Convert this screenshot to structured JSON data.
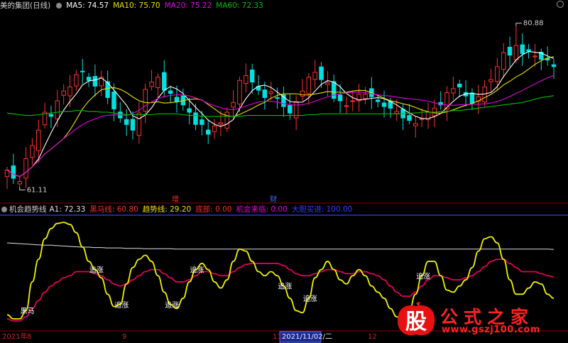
{
  "upper_panel": {
    "stock_name": "美的集团(日线)",
    "ma": [
      {
        "label": "MA5: 74.57",
        "color": "#ffffff"
      },
      {
        "label": "MA10: 75.70",
        "color": "#e8e000"
      },
      {
        "label": "MA20: 75.22",
        "color": "#e000e0"
      },
      {
        "label": "MA60: 72.33",
        "color": "#00c000"
      }
    ],
    "max_label": "80.88",
    "min_label": "61.11"
  },
  "lower_panel": {
    "indicator_name": "机会趋势线",
    "a1_label": "A1: 72.33",
    "items": [
      {
        "label": "黑马线: 60.80",
        "color": "#ff2a2a"
      },
      {
        "label": "趋势线: 29.20",
        "color": "#e8e000"
      },
      {
        "label": "底部: 0.00",
        "color": "#ff2a2a"
      },
      {
        "label": "机会来临: 0.00",
        "color": "#e000e0"
      },
      {
        "label": "大胆买进: 100.00",
        "color": "#3040ff"
      }
    ],
    "event_zeng": "增",
    "event_cai": "财"
  },
  "annotations": {
    "heima": "黑马",
    "zhuizhang": "追涨"
  },
  "time_axis": {
    "year": "2021年",
    "m8": "8",
    "m9": "9",
    "m11": "11",
    "m12": "12",
    "cursor_date": "2021/11/02/二"
  },
  "watermark": {
    "logo_char": "股",
    "title": "公式之家",
    "url": "www.gszj100.com"
  },
  "chart_data": [
    {
      "type": "candlestick",
      "title": "美的集团(日线)",
      "series_names": [
        "MA5",
        "MA10",
        "MA20",
        "MA60"
      ],
      "colors": {
        "up": "#ff3030",
        "down": "#00e0e0",
        "ma5": "#ffffff",
        "ma10": "#e8e000",
        "ma20": "#e000e0",
        "ma60": "#00c000"
      },
      "ylim": [
        59.5,
        82.5
      ],
      "highest": 80.88,
      "lowest": 61.11,
      "close": [
        63.2,
        62.2,
        61.8,
        64.6,
        66.2,
        68.1,
        70.3,
        69.8,
        71.7,
        72.9,
        73.4,
        74.9,
        75.3,
        74.2,
        73.5,
        74.6,
        72.1,
        70.7,
        69.6,
        68.8,
        68.1,
        70.2,
        73.1,
        74.0,
        74.6,
        73.0,
        72.6,
        71.6,
        71.2,
        70.3,
        68.8,
        68.8,
        67.6,
        68.6,
        69.0,
        70.3,
        71.5,
        74.2,
        74.8,
        74.0,
        73.0,
        72.1,
        72.8,
        72.0,
        71.0,
        70.2,
        71.6,
        72.9,
        74.6,
        75.2,
        74.3,
        73.9,
        72.0,
        71.7,
        71.1,
        71.7,
        72.5,
        72.5,
        72.2,
        71.6,
        71.0,
        70.8,
        70.4,
        69.6,
        69.3,
        68.9,
        69.5,
        70.3,
        70.8,
        71.2,
        72.7,
        73.2,
        73.4,
        72.3,
        71.4,
        72.2,
        73.4,
        74.3,
        75.9,
        77.6,
        77.3,
        78.5,
        77.5,
        77.8,
        77.2,
        76.8,
        76.7,
        75.9
      ],
      "ma60": [
        70.2,
        70.1,
        70.0,
        69.9,
        69.9,
        70.0,
        70.1,
        70.2,
        70.3,
        70.4,
        70.4,
        70.5,
        70.5,
        70.4,
        70.4,
        70.3,
        70.3,
        70.2,
        70.1,
        70.0,
        70.0,
        70.0,
        70.0,
        70.0,
        70.1,
        70.1,
        70.1,
        70.1,
        70.0,
        69.9,
        69.9,
        69.8,
        69.8,
        69.8,
        69.8,
        69.8,
        69.8,
        69.8,
        69.9,
        69.9,
        69.9,
        69.9,
        69.9,
        69.9,
        69.9,
        69.9,
        69.9,
        69.9,
        70.0,
        70.0,
        70.1,
        70.1,
        70.1,
        70.1,
        70.1,
        70.1,
        70.1,
        70.1,
        70.1,
        70.1,
        70.1,
        70.1,
        70.1,
        70.1,
        70.2,
        70.2,
        70.3,
        70.3,
        70.3,
        70.4,
        70.4,
        70.5,
        70.5,
        70.6,
        70.7,
        70.8,
        70.9,
        71.0,
        71.1,
        71.2,
        71.3,
        71.4,
        71.5,
        71.7,
        71.9,
        72.1,
        72.2,
        72.33
      ]
    },
    {
      "type": "line",
      "title": "机会趋势线",
      "series_names": [
        "黑马线",
        "趋势线",
        "A1"
      ],
      "colors": {
        "heima": "#e0005a",
        "trend": "#f0f000",
        "a1": "#e0e0e0",
        "top_line": "#3040ff"
      },
      "ylim": [
        -5,
        105
      ],
      "trend": [
        8,
        4,
        4,
        12,
        40,
        62,
        82,
        92,
        97,
        98,
        96,
        88,
        74,
        60,
        52,
        44,
        28,
        16,
        18,
        38,
        54,
        62,
        66,
        60,
        46,
        30,
        18,
        14,
        24,
        40,
        52,
        58,
        52,
        40,
        34,
        42,
        60,
        72,
        70,
        60,
        50,
        46,
        50,
        46,
        36,
        24,
        12,
        10,
        24,
        44,
        52,
        60,
        52,
        42,
        38,
        46,
        52,
        46,
        36,
        30,
        24,
        14,
        6,
        2,
        12,
        28,
        46,
        60,
        60,
        46,
        32,
        30,
        36,
        42,
        54,
        70,
        82,
        84,
        78,
        62,
        42,
        28,
        28,
        34,
        40,
        38,
        28,
        24
      ],
      "heima": [
        4,
        2,
        2,
        6,
        14,
        22,
        30,
        36,
        40,
        44,
        46,
        50,
        50,
        50,
        48,
        46,
        42,
        38,
        36,
        38,
        42,
        46,
        50,
        52,
        52,
        48,
        44,
        40,
        40,
        42,
        46,
        50,
        50,
        48,
        46,
        46,
        50,
        54,
        57,
        58,
        58,
        58,
        58,
        58,
        56,
        52,
        48,
        46,
        46,
        48,
        50,
        52,
        52,
        50,
        48,
        48,
        50,
        50,
        48,
        46,
        42,
        36,
        30,
        26,
        26,
        30,
        36,
        42,
        46,
        46,
        44,
        42,
        42,
        44,
        46,
        50,
        55,
        60,
        62,
        62,
        58,
        54,
        50,
        50,
        50,
        48,
        46,
        45
      ],
      "a1": [
        74.0,
        73.9,
        73.8,
        73.7,
        73.6,
        73.5,
        73.4,
        73.4,
        73.3,
        73.2,
        73.1,
        73.0,
        72.9,
        72.9,
        72.8,
        72.8,
        72.7,
        72.7,
        72.7,
        72.6,
        72.6,
        72.6,
        72.5,
        72.5,
        72.5,
        72.5,
        72.5,
        72.4,
        72.4,
        72.4,
        72.4,
        72.4,
        72.4,
        72.4,
        72.4,
        72.4,
        72.4,
        72.4,
        72.4,
        72.4,
        72.4,
        72.4,
        72.4,
        72.4,
        72.4,
        72.4,
        72.4,
        72.4,
        72.4,
        72.4,
        72.4,
        72.4,
        72.4,
        72.4,
        72.4,
        72.4,
        72.4,
        72.4,
        72.4,
        72.4,
        72.4,
        72.4,
        72.4,
        72.4,
        72.4,
        72.4,
        72.4,
        72.4,
        72.4,
        72.4,
        72.4,
        72.4,
        72.4,
        72.4,
        72.4,
        72.4,
        72.4,
        72.4,
        72.4,
        72.4,
        72.4,
        72.4,
        72.4,
        72.4,
        72.4,
        72.4,
        72.4,
        72.33
      ]
    }
  ]
}
